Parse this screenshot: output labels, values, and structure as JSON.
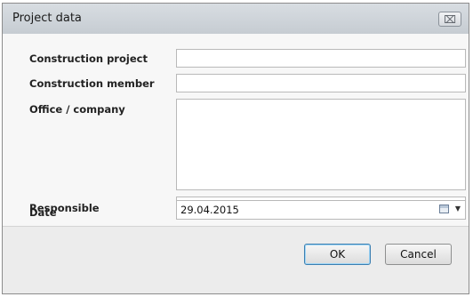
{
  "dialog": {
    "title": "Project data",
    "close_glyph": "⌧"
  },
  "form": {
    "construction_project": {
      "label": "Construction project",
      "value": ""
    },
    "construction_member": {
      "label": "Construction member",
      "value": ""
    },
    "office_company": {
      "label": "Office / company",
      "value": ""
    },
    "responsible": {
      "label": "Responsible",
      "value": ""
    },
    "date": {
      "label": "Date",
      "value": "29.04.2015",
      "icon": "calendar-icon"
    }
  },
  "buttons": {
    "ok": "OK",
    "cancel": "Cancel"
  }
}
